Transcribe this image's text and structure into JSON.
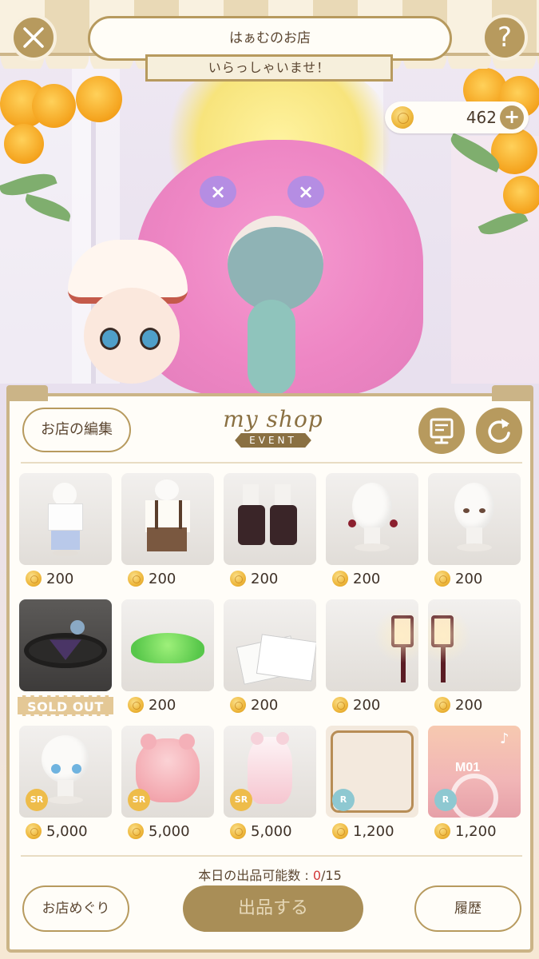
{
  "header": {
    "shop_name": "はぁむのお店",
    "greeting": "いらっしゃいませ！",
    "close_icon": "close-icon",
    "help_label": "?",
    "coins": "462",
    "add_label": "+"
  },
  "panel": {
    "edit_label": "お店の編集",
    "logo_my": "my shop",
    "logo_event": "EVENT",
    "items": [
      {
        "price": "200",
        "name": "outfit-white-shirt-shorts"
      },
      {
        "price": "200",
        "name": "outfit-suspender-shorts"
      },
      {
        "price": "200",
        "name": "boots-dark-brown"
      },
      {
        "price": "200",
        "name": "hair-ribbons"
      },
      {
        "price": "200",
        "name": "face-eyes"
      },
      {
        "price": "",
        "sold_out": "SOLD OUT",
        "name": "record-disc-with-hat"
      },
      {
        "price": "200",
        "name": "green-bush"
      },
      {
        "price": "200",
        "name": "letter-papers"
      },
      {
        "price": "200",
        "name": "street-lamp-left"
      },
      {
        "price": "200",
        "name": "street-lamp-right"
      },
      {
        "price": "5,000",
        "rarity": "SR",
        "name": "face-blue-eyes"
      },
      {
        "price": "5,000",
        "rarity": "SR",
        "name": "hair-pink-curly"
      },
      {
        "price": "5,000",
        "rarity": "SR",
        "name": "hair-pink-buns"
      },
      {
        "price": "1,200",
        "rarity": "R",
        "name": "frame-ornate"
      },
      {
        "price": "1,200",
        "rarity": "R",
        "name": "music-m01",
        "caption": "M01"
      }
    ],
    "stock_label": "本日の出品可能数 : ",
    "stock_current": "0",
    "stock_total": "/15",
    "tour_label": "お店めぐり",
    "list_label": "出品する",
    "history_label": "履歴"
  },
  "colors": {
    "accent": "#b79a5e",
    "panel_border": "#cbb487",
    "stock_highlight": "#d23a3a"
  }
}
